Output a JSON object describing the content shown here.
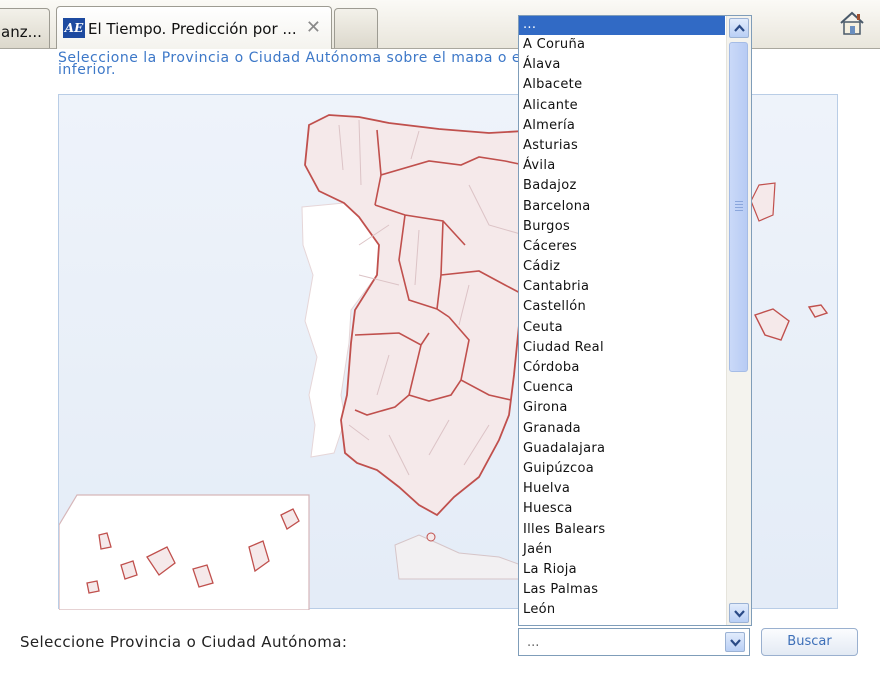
{
  "tabs": [
    {
      "label": "anz..."
    },
    {
      "label": "El Tiempo. Predicción por ...",
      "icon_text": "AE"
    }
  ],
  "page": {
    "intro_line1": "Seleccione la Provincia o Ciudad Autónoma sobre el mapa o en el desplegable",
    "intro_line2": "inferior."
  },
  "form": {
    "label": "Seleccione Provincia o Ciudad Autónoma:",
    "selected": "...",
    "search_button": "Buscar"
  },
  "dropdown": {
    "options": [
      "...",
      "A Coruña",
      "Álava",
      "Albacete",
      "Alicante",
      "Almería",
      "Asturias",
      "Ávila",
      "Badajoz",
      "Barcelona",
      "Burgos",
      "Cáceres",
      "Cádiz",
      "Cantabria",
      "Castellón",
      "Ceuta",
      "Ciudad Real",
      "Córdoba",
      "Cuenca",
      "Girona",
      "Granada",
      "Guadalajara",
      "Guipúzcoa",
      "Huelva",
      "Huesca",
      "Illes Balears",
      "Jaén",
      "La Rioja",
      "Las Palmas",
      "León"
    ]
  },
  "colors": {
    "link_blue": "#3d78c8",
    "selection": "#316ac5",
    "region_border": "#c0504d",
    "province_fill": "#f5e9ea"
  }
}
